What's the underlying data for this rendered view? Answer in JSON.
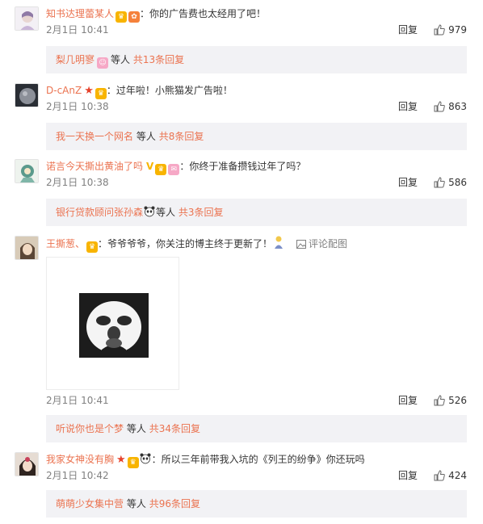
{
  "comments": [
    {
      "username": "知书达理蕾某人",
      "text": "：你的广告费也太经用了吧！",
      "time": "2月1日 10:41",
      "reply_label": "回复",
      "likes": "979",
      "sub": {
        "name": "梨几明寥",
        "suffix": "等人",
        "count": "共13条回复"
      }
    },
    {
      "username": "D-cAnZ",
      "text": "：过年啦！小熊猫发广告啦！",
      "time": "2月1日 10:38",
      "reply_label": "回复",
      "likes": "863",
      "sub": {
        "name": "我一天换一个网名",
        "suffix": "等人",
        "count": "共8条回复"
      }
    },
    {
      "username": "诺言今天撕出黄油了吗",
      "text": "：你终于准备攒钱过年了吗？",
      "time": "2月1日 10:38",
      "reply_label": "回复",
      "likes": "586",
      "sub": {
        "name": "银行贷款顾问张孙森",
        "suffix": "等人",
        "count": "共3条回复"
      }
    },
    {
      "username": "王撕葱、",
      "text": "：爷爷爷爷，你关注的博主终于更新了！",
      "picture_link": "评论配图",
      "time": "2月1日 10:41",
      "reply_label": "回复",
      "likes": "526",
      "sub": {
        "name": "听说你也是个梦",
        "suffix": "等人",
        "count": "共34条回复"
      }
    },
    {
      "username": "我家女神没有胸",
      "text": "：所以三年前带我入坑的《列王的纷争》你还玩吗",
      "time": "2月1日 10:42",
      "reply_label": "回复",
      "likes": "424",
      "sub": {
        "name": "萌萌少女集中营",
        "suffix": "等人",
        "count": "共96条回复"
      }
    }
  ],
  "colors": {
    "username": "#eb7350",
    "meta": "#808080",
    "sub_bg": "#f2f2f5",
    "badge": "#f8b400"
  },
  "icons": {
    "like": "thumbs-up-icon",
    "picture": "image-icon",
    "member": "crown-badge-icon"
  }
}
